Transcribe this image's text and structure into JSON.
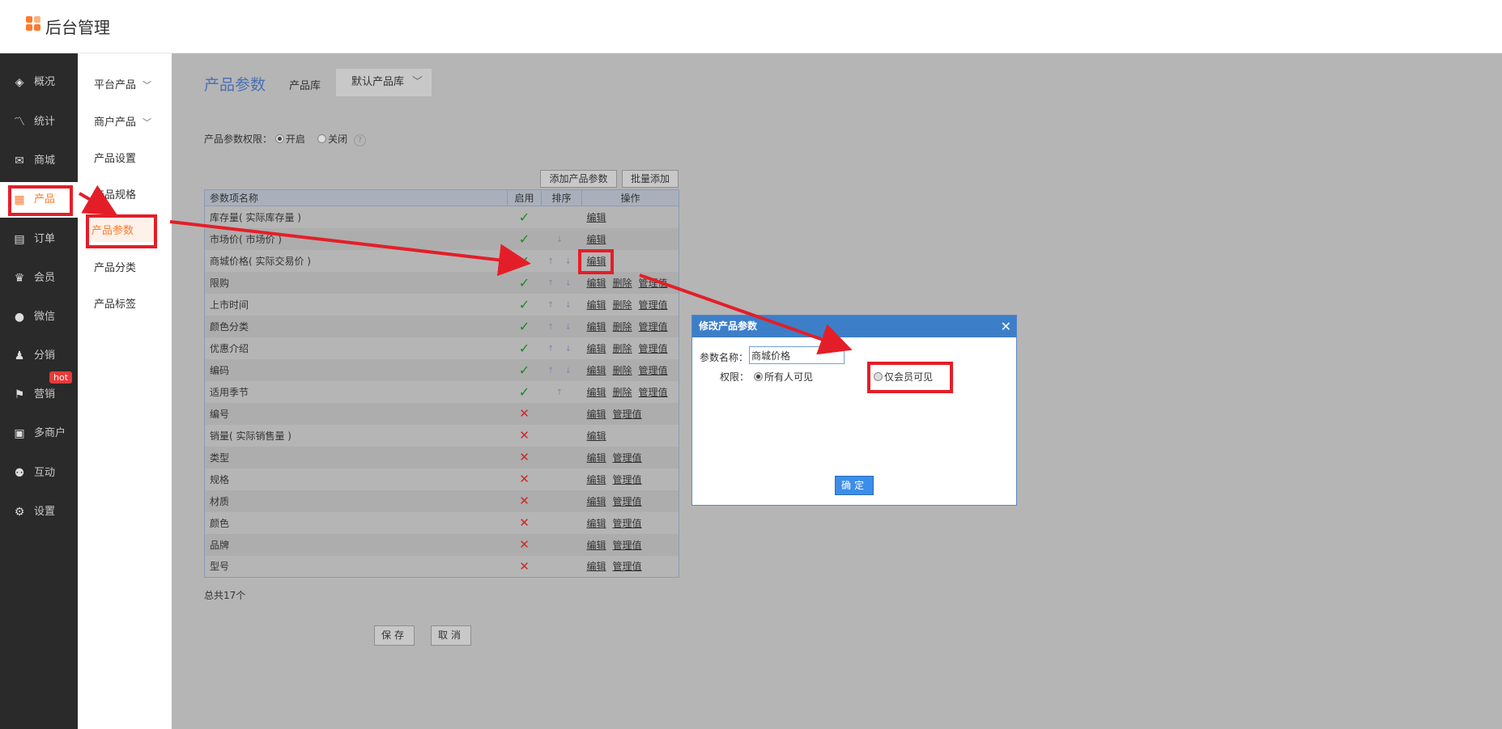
{
  "app": {
    "title": "后台管理"
  },
  "leftnav": {
    "items": [
      {
        "label": "概况",
        "icon": "layers-icon"
      },
      {
        "label": "统计",
        "icon": "chart-icon"
      },
      {
        "label": "商城",
        "icon": "mail-icon"
      },
      {
        "label": "产品",
        "icon": "grid-icon"
      },
      {
        "label": "订单",
        "icon": "clipboard-icon"
      },
      {
        "label": "会员",
        "icon": "crown-icon"
      },
      {
        "label": "微信",
        "icon": "chat-icon"
      },
      {
        "label": "分销",
        "icon": "user-share-icon"
      },
      {
        "label": "营销",
        "icon": "flag-icon"
      },
      {
        "label": "多商户",
        "icon": "store-icon"
      },
      {
        "label": "互动",
        "icon": "interact-icon"
      },
      {
        "label": "设置",
        "icon": "gear-icon"
      }
    ],
    "hot_badge": "hot"
  },
  "subnav": {
    "items": [
      {
        "label": "平台产品"
      },
      {
        "label": "商户产品"
      },
      {
        "label": "产品设置"
      },
      {
        "label": "产品规格"
      },
      {
        "label": "产品参数"
      },
      {
        "label": "产品分类"
      },
      {
        "label": "产品标签"
      }
    ]
  },
  "main": {
    "title": "产品参数",
    "library_label": "产品库",
    "library_value": "默认产品库",
    "permission_label": "产品参数权限：",
    "permission_on": "开启",
    "permission_off": "关闭",
    "help": "?",
    "add_button": "添加产品参数",
    "batch_button": "批量添加",
    "table": {
      "headers": [
        "参数项名称",
        "启用",
        "排序",
        "操作"
      ],
      "rows": [
        {
          "name": "库存量( 实际库存量 )",
          "enabled": true,
          "ops": [
            "编辑"
          ]
        },
        {
          "name": "市场价( 市场价 )",
          "enabled": true,
          "ops": [
            "编辑"
          ]
        },
        {
          "name": "商城价格( 实际交易价 )",
          "enabled": true,
          "ops": [
            "编辑"
          ]
        },
        {
          "name": "限购",
          "enabled": true,
          "ops": [
            "编辑",
            "删除",
            "管理值"
          ]
        },
        {
          "name": "上市时间",
          "enabled": true,
          "ops": [
            "编辑",
            "删除",
            "管理值"
          ]
        },
        {
          "name": "颜色分类",
          "enabled": true,
          "ops": [
            "编辑",
            "删除",
            "管理值"
          ]
        },
        {
          "name": "优惠介绍",
          "enabled": true,
          "ops": [
            "编辑",
            "删除",
            "管理值"
          ]
        },
        {
          "name": "编码",
          "enabled": true,
          "ops": [
            "编辑",
            "删除",
            "管理值"
          ]
        },
        {
          "name": "适用季节",
          "enabled": true,
          "ops": [
            "编辑",
            "删除",
            "管理值"
          ]
        },
        {
          "name": "编号",
          "enabled": false,
          "ops": [
            "编辑",
            "管理值"
          ]
        },
        {
          "name": "销量( 实际销售量 )",
          "enabled": false,
          "ops": [
            "编辑"
          ]
        },
        {
          "name": "类型",
          "enabled": false,
          "ops": [
            "编辑",
            "管理值"
          ]
        },
        {
          "name": "规格",
          "enabled": false,
          "ops": [
            "编辑",
            "管理值"
          ]
        },
        {
          "name": "材质",
          "enabled": false,
          "ops": [
            "编辑",
            "管理值"
          ]
        },
        {
          "name": "颜色",
          "enabled": false,
          "ops": [
            "编辑",
            "管理值"
          ]
        },
        {
          "name": "品牌",
          "enabled": false,
          "ops": [
            "编辑",
            "管理值"
          ]
        },
        {
          "name": "型号",
          "enabled": false,
          "ops": [
            "编辑",
            "管理值"
          ]
        }
      ]
    },
    "total": "总共17个",
    "save_button": "保存",
    "cancel_button": "取消"
  },
  "dialog": {
    "title": "修改产品参数",
    "close": "✕",
    "name_label": "参数名称：",
    "name_value": "商城价格",
    "perm_label": "权限：",
    "option_all": "所有人可见",
    "option_members": "仅会员可见",
    "ok_button": "确定"
  },
  "colors": {
    "accent": "#ff7a2f",
    "annotation": "#e41e28",
    "dialog_header": "#3c7fc8"
  }
}
